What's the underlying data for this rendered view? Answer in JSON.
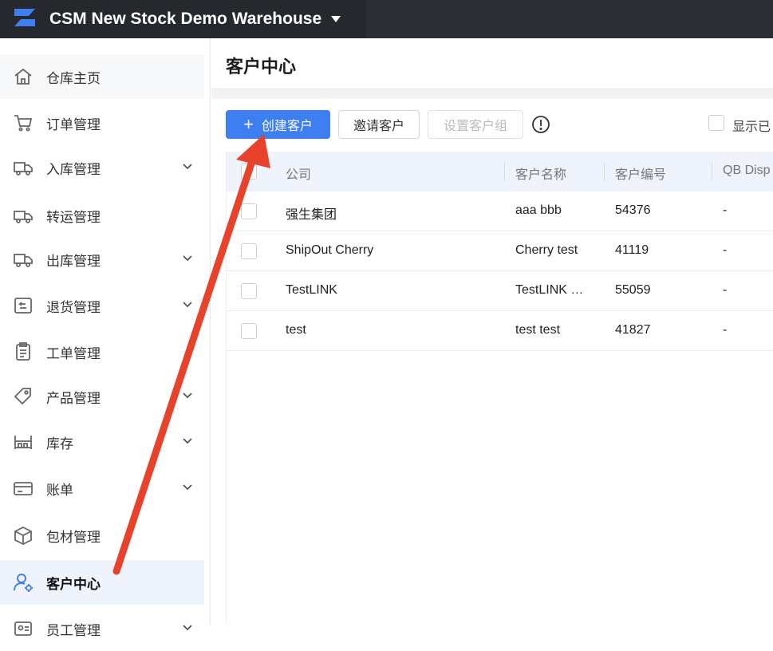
{
  "topbar": {
    "warehouse_name": "CSM New Stock Demo Warehouse"
  },
  "sidebar": {
    "items": [
      {
        "label": "仓库主页",
        "icon": "home-icon"
      },
      {
        "label": "订单管理",
        "icon": "cart-icon"
      },
      {
        "label": "入库管理",
        "icon": "inbound-truck-icon"
      },
      {
        "label": "转运管理",
        "icon": "transfer-truck-icon"
      },
      {
        "label": "出库管理",
        "icon": "outbound-truck-icon"
      },
      {
        "label": "退货管理",
        "icon": "return-icon"
      },
      {
        "label": "工单管理",
        "icon": "clipboard-icon"
      },
      {
        "label": "产品管理",
        "icon": "tag-icon"
      },
      {
        "label": "库存",
        "icon": "shelf-icon"
      },
      {
        "label": "账单",
        "icon": "card-icon"
      },
      {
        "label": "包材管理",
        "icon": "box-icon"
      },
      {
        "label": "客户中心",
        "icon": "user-gear-icon"
      },
      {
        "label": "员工管理",
        "icon": "staff-icon"
      }
    ]
  },
  "page": {
    "title": "客户中心"
  },
  "toolbar": {
    "create_label": "创建客户",
    "invite_label": "邀请客户",
    "group_label": "设置客户组",
    "show_label": "显示已"
  },
  "table": {
    "headers": [
      "公司",
      "客户名称",
      "客户编号",
      "QB Disp"
    ],
    "rows": [
      {
        "company": "强生集团",
        "name": "aaa bbb",
        "code": "54376",
        "qb": "-"
      },
      {
        "company": "ShipOut Cherry",
        "name": "Cherry test",
        "code": "41119",
        "qb": "-"
      },
      {
        "company": "TestLINK",
        "name": "TestLINK …",
        "code": "55059",
        "qb": "-"
      },
      {
        "company": "test",
        "name": "test test",
        "code": "41827",
        "qb": "-"
      }
    ]
  },
  "colors": {
    "primary": "#3d7ff0",
    "topbar": "#2b2f33",
    "annotation_arrow": "#e8412c",
    "active_bg": "#eef3fc"
  }
}
